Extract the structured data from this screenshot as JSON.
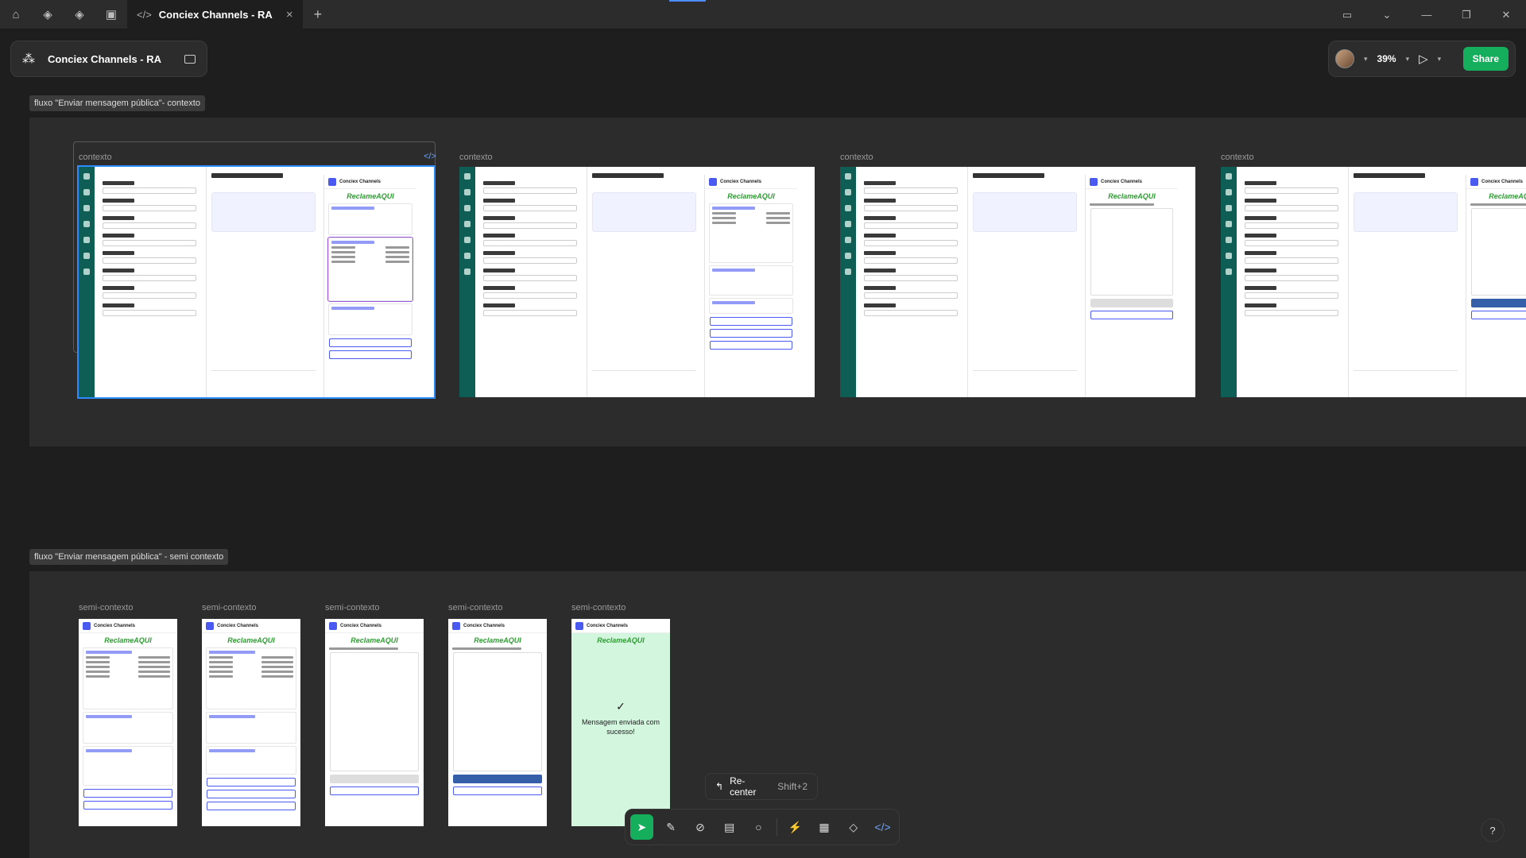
{
  "titlebar": {
    "home_icon": "home-icon",
    "tab_label": "Conciex Channels - RA",
    "close_glyph": "×",
    "add_glyph": "+"
  },
  "file": {
    "name": "Conciex Channels - RA"
  },
  "toolbar_right": {
    "zoom": "39%",
    "share_label": "Share"
  },
  "sections": {
    "contexto": {
      "label": "fluxo \"Enviar mensagem pública\"- contexto",
      "frames": [
        "contexto",
        "contexto",
        "contexto",
        "contexto"
      ]
    },
    "semi": {
      "label": "fluxo \"Enviar mensagem pública\" - semi contexto",
      "frames": [
        "semi-contexto",
        "semi-contexto",
        "semi-contexto",
        "semi-contexto",
        "semi-contexto"
      ]
    }
  },
  "mockup": {
    "app_name": "Conciex Channels",
    "logo_text": "ReclameAQUI",
    "success_message": "Mensagem enviada com sucesso!"
  },
  "recenter": {
    "label": "Re-center",
    "shortcut": "Shift+2"
  },
  "help": "?"
}
